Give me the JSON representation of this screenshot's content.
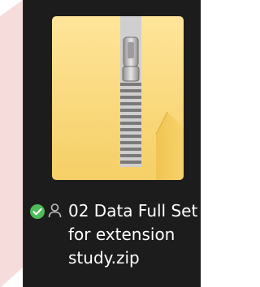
{
  "file": {
    "name_lines": [
      "02 Data Full Set",
      "for extension",
      "study.zip"
    ],
    "icon": "zip-folder-icon",
    "sync_status_icon": "synced-check-icon",
    "shared_icon": "person-icon"
  },
  "colors": {
    "tile_background": "#1c1c1c",
    "backdrop_pink": "#f7dcdc",
    "folder_yellow": "#f8d775",
    "sync_green": "#4cbb58",
    "text": "#ffffff"
  }
}
